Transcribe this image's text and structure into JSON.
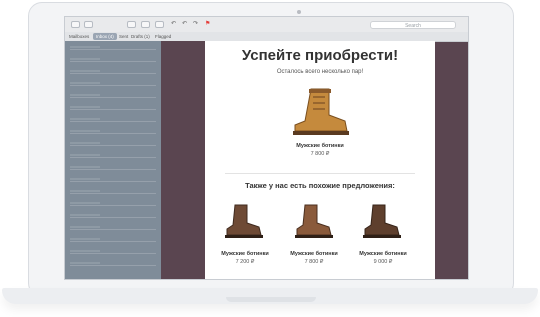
{
  "toolbar": {
    "search_placeholder": "Search"
  },
  "favorites": [
    "Mailboxes",
    "Inbox (4)",
    "Sent",
    "Drafts (1)",
    "Flagged"
  ],
  "email": {
    "headline": "Успейте приобрести!",
    "subtitle": "Осталось всего несколько пар!",
    "main_product": {
      "name": "Мужские ботинки",
      "price": "7 800 ₽"
    },
    "also_title": "Также у нас есть похожие предложения:",
    "similar": [
      {
        "name": "Мужские ботинки",
        "price": "7 200 ₽"
      },
      {
        "name": "Мужские ботинки",
        "price": "7 800 ₽"
      },
      {
        "name": "Мужские ботинки",
        "price": "9 000 ₽"
      }
    ]
  },
  "colors": {
    "screen_bg": "#5a4550",
    "sidebar_bg": "#7f8c99",
    "boot_tan": "#c58a3d",
    "boot_brown": "#6e4a35"
  }
}
